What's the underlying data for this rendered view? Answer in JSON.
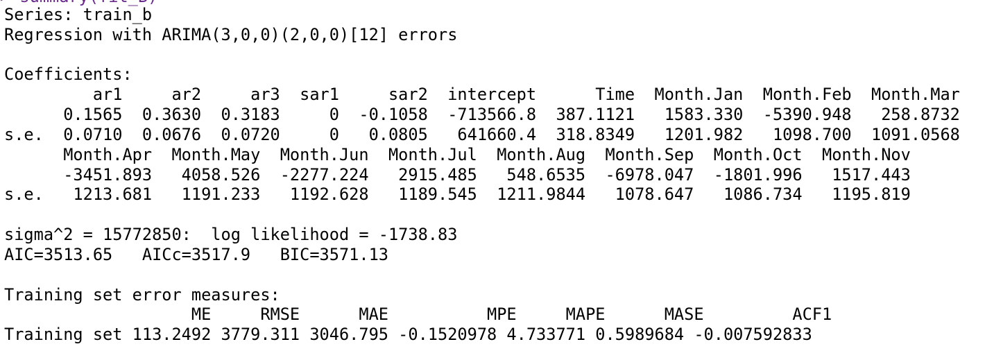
{
  "console": {
    "cutoff_command": "> summary(fit_B)",
    "lines": [
      "Series: train_b ",
      "Regression with ARIMA(3,0,0)(2,0,0)[12] errors ",
      "",
      "Coefficients:",
      "         ar1     ar2     ar3  sar1     sar2  intercept      Time  Month.Jan  Month.Feb  Month.Mar",
      "      0.1565  0.3630  0.3183     0  -0.1058  -713566.8  387.1121   1583.330  -5390.948   258.8732",
      "s.e.  0.0710  0.0676  0.0720     0   0.0805   641660.4  318.8349   1201.982   1098.700  1091.0568",
      "      Month.Apr  Month.May  Month.Jun  Month.Jul  Month.Aug  Month.Sep  Month.Oct  Month.Nov",
      "      -3451.893   4058.526  -2277.224   2915.485   548.6535  -6978.047  -1801.996   1517.443",
      "s.e.   1213.681   1191.233   1192.628   1189.545  1211.9844   1078.647   1086.734   1195.819",
      "",
      "sigma^2 = 15772850:  log likelihood = -1738.83",
      "AIC=3513.65   AICc=3517.9   BIC=3571.13",
      "",
      "Training set error measures:",
      "                   ME     RMSE      MAE          MPE     MAPE      MASE         ACF1",
      "Training set 113.2492 3779.311 3046.795 -0.1520978 4.733771 0.5989684 -0.007592833"
    ]
  }
}
